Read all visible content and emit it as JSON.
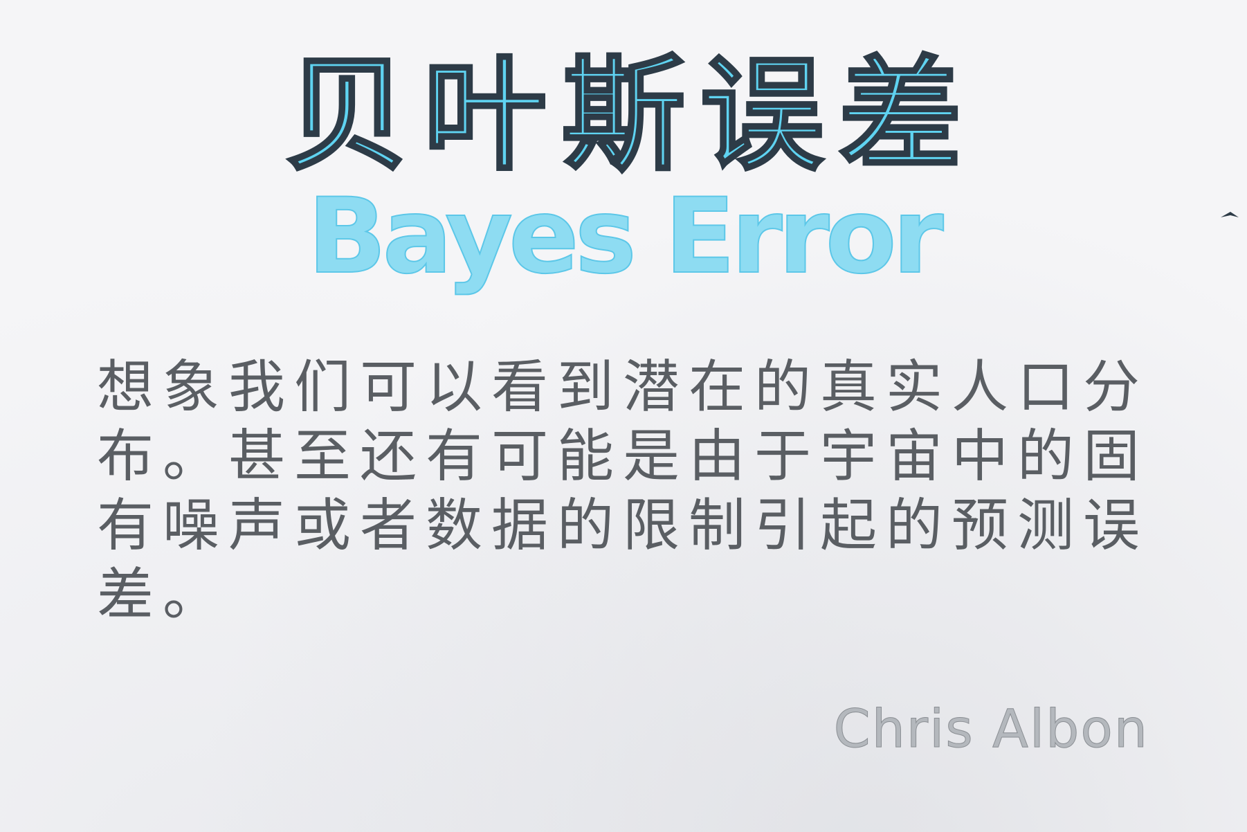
{
  "title_zh": "贝叶斯误差",
  "title_en": "Bayes Error",
  "body": "想象我们可以看到潜在的真实人口分布。甚至还有可能是由于宇宙中的固有噪声或者数据的限制引起的预测误差。",
  "signature": "Chris Albon",
  "colors": {
    "title": "#5fd3f1",
    "title_outline": "#2d3b47",
    "body_text": "#5a5e63",
    "signature": "#b4b8bd",
    "background": "#f5f5f7"
  },
  "icons": {
    "pen_mark": "small-arrow-mark"
  }
}
